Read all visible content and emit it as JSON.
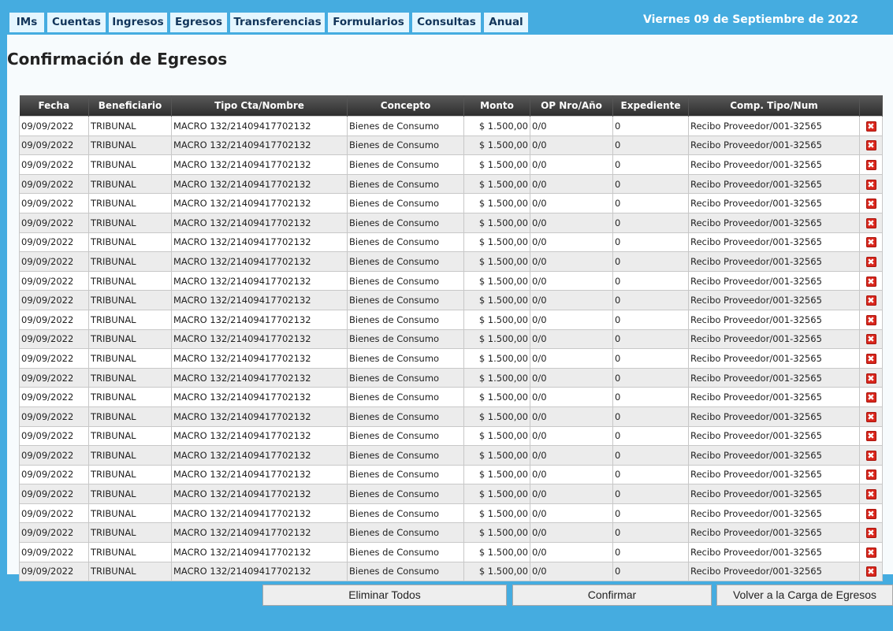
{
  "nav": {
    "items": [
      {
        "label": "IMs"
      },
      {
        "label": "Cuentas"
      },
      {
        "label": "Ingresos"
      },
      {
        "label": "Egresos"
      },
      {
        "label": "Transferencias"
      },
      {
        "label": "Formularios"
      },
      {
        "label": "Consultas"
      },
      {
        "label": "Anual"
      }
    ],
    "date": "Viernes 09 de Septiembre de 2022"
  },
  "page": {
    "title": "Confirmación de Egresos"
  },
  "table": {
    "columns": [
      "Fecha",
      "Beneficiario",
      "Tipo Cta/Nombre",
      "Concepto",
      "Monto",
      "OP Nro/Año",
      "Expediente",
      "Comp. Tipo/Num",
      ""
    ],
    "delete_icon": "delete-x-icon",
    "rows": [
      [
        "09/09/2022",
        "TRIBUNAL",
        "MACRO 132/21409417702132",
        "Bienes de Consumo",
        "$ 1.500,00",
        "0/0",
        "0",
        "Recibo Proveedor/001-32565"
      ],
      [
        "09/09/2022",
        "TRIBUNAL",
        "MACRO 132/21409417702132",
        "Bienes de Consumo",
        "$ 1.500,00",
        "0/0",
        "0",
        "Recibo Proveedor/001-32565"
      ],
      [
        "09/09/2022",
        "TRIBUNAL",
        "MACRO 132/21409417702132",
        "Bienes de Consumo",
        "$ 1.500,00",
        "0/0",
        "0",
        "Recibo Proveedor/001-32565"
      ],
      [
        "09/09/2022",
        "TRIBUNAL",
        "MACRO 132/21409417702132",
        "Bienes de Consumo",
        "$ 1.500,00",
        "0/0",
        "0",
        "Recibo Proveedor/001-32565"
      ],
      [
        "09/09/2022",
        "TRIBUNAL",
        "MACRO 132/21409417702132",
        "Bienes de Consumo",
        "$ 1.500,00",
        "0/0",
        "0",
        "Recibo Proveedor/001-32565"
      ],
      [
        "09/09/2022",
        "TRIBUNAL",
        "MACRO 132/21409417702132",
        "Bienes de Consumo",
        "$ 1.500,00",
        "0/0",
        "0",
        "Recibo Proveedor/001-32565"
      ],
      [
        "09/09/2022",
        "TRIBUNAL",
        "MACRO 132/21409417702132",
        "Bienes de Consumo",
        "$ 1.500,00",
        "0/0",
        "0",
        "Recibo Proveedor/001-32565"
      ],
      [
        "09/09/2022",
        "TRIBUNAL",
        "MACRO 132/21409417702132",
        "Bienes de Consumo",
        "$ 1.500,00",
        "0/0",
        "0",
        "Recibo Proveedor/001-32565"
      ],
      [
        "09/09/2022",
        "TRIBUNAL",
        "MACRO 132/21409417702132",
        "Bienes de Consumo",
        "$ 1.500,00",
        "0/0",
        "0",
        "Recibo Proveedor/001-32565"
      ],
      [
        "09/09/2022",
        "TRIBUNAL",
        "MACRO 132/21409417702132",
        "Bienes de Consumo",
        "$ 1.500,00",
        "0/0",
        "0",
        "Recibo Proveedor/001-32565"
      ],
      [
        "09/09/2022",
        "TRIBUNAL",
        "MACRO 132/21409417702132",
        "Bienes de Consumo",
        "$ 1.500,00",
        "0/0",
        "0",
        "Recibo Proveedor/001-32565"
      ],
      [
        "09/09/2022",
        "TRIBUNAL",
        "MACRO 132/21409417702132",
        "Bienes de Consumo",
        "$ 1.500,00",
        "0/0",
        "0",
        "Recibo Proveedor/001-32565"
      ],
      [
        "09/09/2022",
        "TRIBUNAL",
        "MACRO 132/21409417702132",
        "Bienes de Consumo",
        "$ 1.500,00",
        "0/0",
        "0",
        "Recibo Proveedor/001-32565"
      ],
      [
        "09/09/2022",
        "TRIBUNAL",
        "MACRO 132/21409417702132",
        "Bienes de Consumo",
        "$ 1.500,00",
        "0/0",
        "0",
        "Recibo Proveedor/001-32565"
      ],
      [
        "09/09/2022",
        "TRIBUNAL",
        "MACRO 132/21409417702132",
        "Bienes de Consumo",
        "$ 1.500,00",
        "0/0",
        "0",
        "Recibo Proveedor/001-32565"
      ],
      [
        "09/09/2022",
        "TRIBUNAL",
        "MACRO 132/21409417702132",
        "Bienes de Consumo",
        "$ 1.500,00",
        "0/0",
        "0",
        "Recibo Proveedor/001-32565"
      ],
      [
        "09/09/2022",
        "TRIBUNAL",
        "MACRO 132/21409417702132",
        "Bienes de Consumo",
        "$ 1.500,00",
        "0/0",
        "0",
        "Recibo Proveedor/001-32565"
      ],
      [
        "09/09/2022",
        "TRIBUNAL",
        "MACRO 132/21409417702132",
        "Bienes de Consumo",
        "$ 1.500,00",
        "0/0",
        "0",
        "Recibo Proveedor/001-32565"
      ],
      [
        "09/09/2022",
        "TRIBUNAL",
        "MACRO 132/21409417702132",
        "Bienes de Consumo",
        "$ 1.500,00",
        "0/0",
        "0",
        "Recibo Proveedor/001-32565"
      ],
      [
        "09/09/2022",
        "TRIBUNAL",
        "MACRO 132/21409417702132",
        "Bienes de Consumo",
        "$ 1.500,00",
        "0/0",
        "0",
        "Recibo Proveedor/001-32565"
      ],
      [
        "09/09/2022",
        "TRIBUNAL",
        "MACRO 132/21409417702132",
        "Bienes de Consumo",
        "$ 1.500,00",
        "0/0",
        "0",
        "Recibo Proveedor/001-32565"
      ],
      [
        "09/09/2022",
        "TRIBUNAL",
        "MACRO 132/21409417702132",
        "Bienes de Consumo",
        "$ 1.500,00",
        "0/0",
        "0",
        "Recibo Proveedor/001-32565"
      ],
      [
        "09/09/2022",
        "TRIBUNAL",
        "MACRO 132/21409417702132",
        "Bienes de Consumo",
        "$ 1.500,00",
        "0/0",
        "0",
        "Recibo Proveedor/001-32565"
      ],
      [
        "09/09/2022",
        "TRIBUNAL",
        "MACRO 132/21409417702132",
        "Bienes de Consumo",
        "$ 1.500,00",
        "0/0",
        "0",
        "Recibo Proveedor/001-32565"
      ]
    ]
  },
  "actions": {
    "delete_all": "Eliminar Todos",
    "confirm": "Confirmar",
    "back": "Volver a la Carga de Egresos"
  },
  "colors": {
    "frame_blue": "#45ace0",
    "nav_tab_bg": "#e4f6ff",
    "header_dark": "#3b3b3b",
    "delete_red": "#d9261c"
  }
}
